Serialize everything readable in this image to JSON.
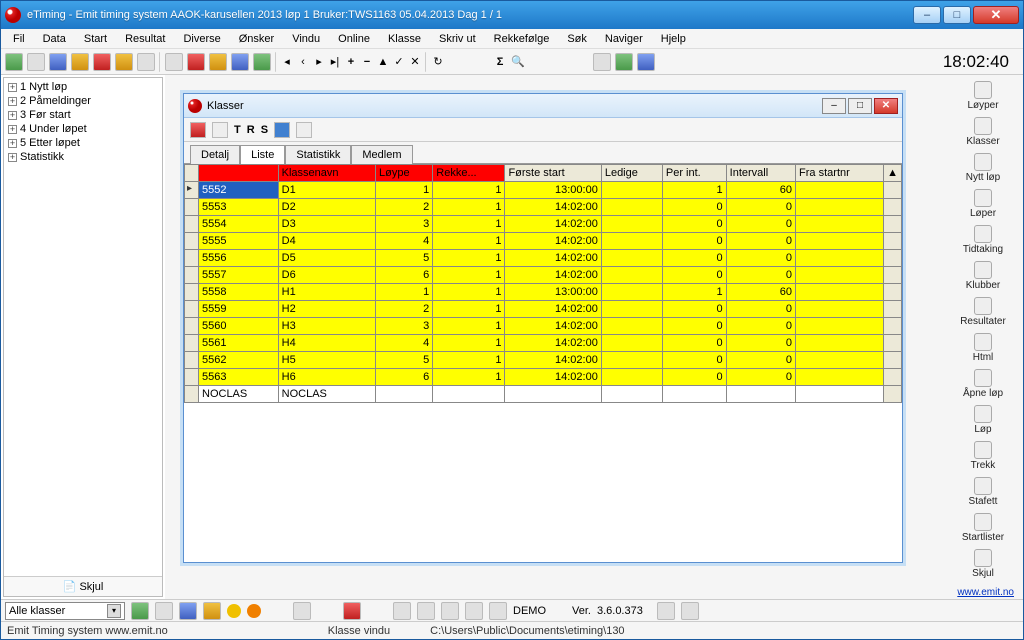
{
  "title": "eTiming - Emit timing system  AAOK-karusellen 2013 løp 1   Bruker:TWS1163   05.04.2013   Dag 1 / 1",
  "menu": [
    "Fil",
    "Data",
    "Start",
    "Resultat",
    "Diverse",
    "Ønsker",
    "Vindu",
    "Online",
    "Klasse",
    "Skriv ut",
    "Rekkefølge",
    "Søk",
    "Naviger",
    "Hjelp"
  ],
  "clock": "18:02:40",
  "tree": [
    "1 Nytt løp",
    "2 Påmeldinger",
    "3 Før start",
    "4 Under løpet",
    "5 Etter løpet",
    "Statistikk"
  ],
  "tree_footer": "Skjul",
  "right": [
    "Løyper",
    "Klasser",
    "Nytt løp",
    "Løper",
    "Tidtaking",
    "Klubber",
    "Resultater",
    "Html",
    "Åpne løp",
    "Løp",
    "Trekk",
    "Stafett",
    "Startlister"
  ],
  "right_footer": "Skjul",
  "right_link": "www.emit.no",
  "child": {
    "title": "Klasser",
    "tool_letters": [
      "T",
      "R",
      "S"
    ],
    "tabs": [
      "Detalj",
      "Liste",
      "Statistikk",
      "Medlem"
    ],
    "active_tab": 1,
    "columns": [
      "",
      "",
      "Klassenavn",
      "Løype",
      "Rekke...",
      "Første start",
      "Ledige",
      "Per int.",
      "Intervall",
      "Fra startnr"
    ],
    "rows": [
      {
        "id": "5552",
        "navn": "D1",
        "loype": "1",
        "rekke": "1",
        "start": "13:00:00",
        "ledige": "",
        "per": "1",
        "int": "60",
        "fra": "",
        "sel": true
      },
      {
        "id": "5553",
        "navn": "D2",
        "loype": "2",
        "rekke": "1",
        "start": "14:02:00",
        "ledige": "",
        "per": "0",
        "int": "0",
        "fra": ""
      },
      {
        "id": "5554",
        "navn": "D3",
        "loype": "3",
        "rekke": "1",
        "start": "14:02:00",
        "ledige": "",
        "per": "0",
        "int": "0",
        "fra": ""
      },
      {
        "id": "5555",
        "navn": "D4",
        "loype": "4",
        "rekke": "1",
        "start": "14:02:00",
        "ledige": "",
        "per": "0",
        "int": "0",
        "fra": ""
      },
      {
        "id": "5556",
        "navn": "D5",
        "loype": "5",
        "rekke": "1",
        "start": "14:02:00",
        "ledige": "",
        "per": "0",
        "int": "0",
        "fra": ""
      },
      {
        "id": "5557",
        "navn": "D6",
        "loype": "6",
        "rekke": "1",
        "start": "14:02:00",
        "ledige": "",
        "per": "0",
        "int": "0",
        "fra": ""
      },
      {
        "id": "5558",
        "navn": "H1",
        "loype": "1",
        "rekke": "1",
        "start": "13:00:00",
        "ledige": "",
        "per": "1",
        "int": "60",
        "fra": ""
      },
      {
        "id": "5559",
        "navn": "H2",
        "loype": "2",
        "rekke": "1",
        "start": "14:02:00",
        "ledige": "",
        "per": "0",
        "int": "0",
        "fra": ""
      },
      {
        "id": "5560",
        "navn": "H3",
        "loype": "3",
        "rekke": "1",
        "start": "14:02:00",
        "ledige": "",
        "per": "0",
        "int": "0",
        "fra": ""
      },
      {
        "id": "5561",
        "navn": "H4",
        "loype": "4",
        "rekke": "1",
        "start": "14:02:00",
        "ledige": "",
        "per": "0",
        "int": "0",
        "fra": ""
      },
      {
        "id": "5562",
        "navn": "H5",
        "loype": "5",
        "rekke": "1",
        "start": "14:02:00",
        "ledige": "",
        "per": "0",
        "int": "0",
        "fra": ""
      },
      {
        "id": "5563",
        "navn": "H6",
        "loype": "6",
        "rekke": "1",
        "start": "14:02:00",
        "ledige": "",
        "per": "0",
        "int": "0",
        "fra": ""
      },
      {
        "id": "NOCLAS",
        "navn": "NOCLAS",
        "loype": "",
        "rekke": "",
        "start": "",
        "ledige": "",
        "per": "",
        "int": "",
        "fra": "",
        "plain": true
      }
    ]
  },
  "bottom": {
    "dropdown": "Alle klasser",
    "demo": "DEMO",
    "ver_label": "Ver.",
    "ver": "3.6.0.373"
  },
  "status": {
    "left": "Emit Timing system www.emit.no",
    "mid": "Klasse vindu",
    "path": "C:\\Users\\Public\\Documents\\etiming\\130"
  }
}
